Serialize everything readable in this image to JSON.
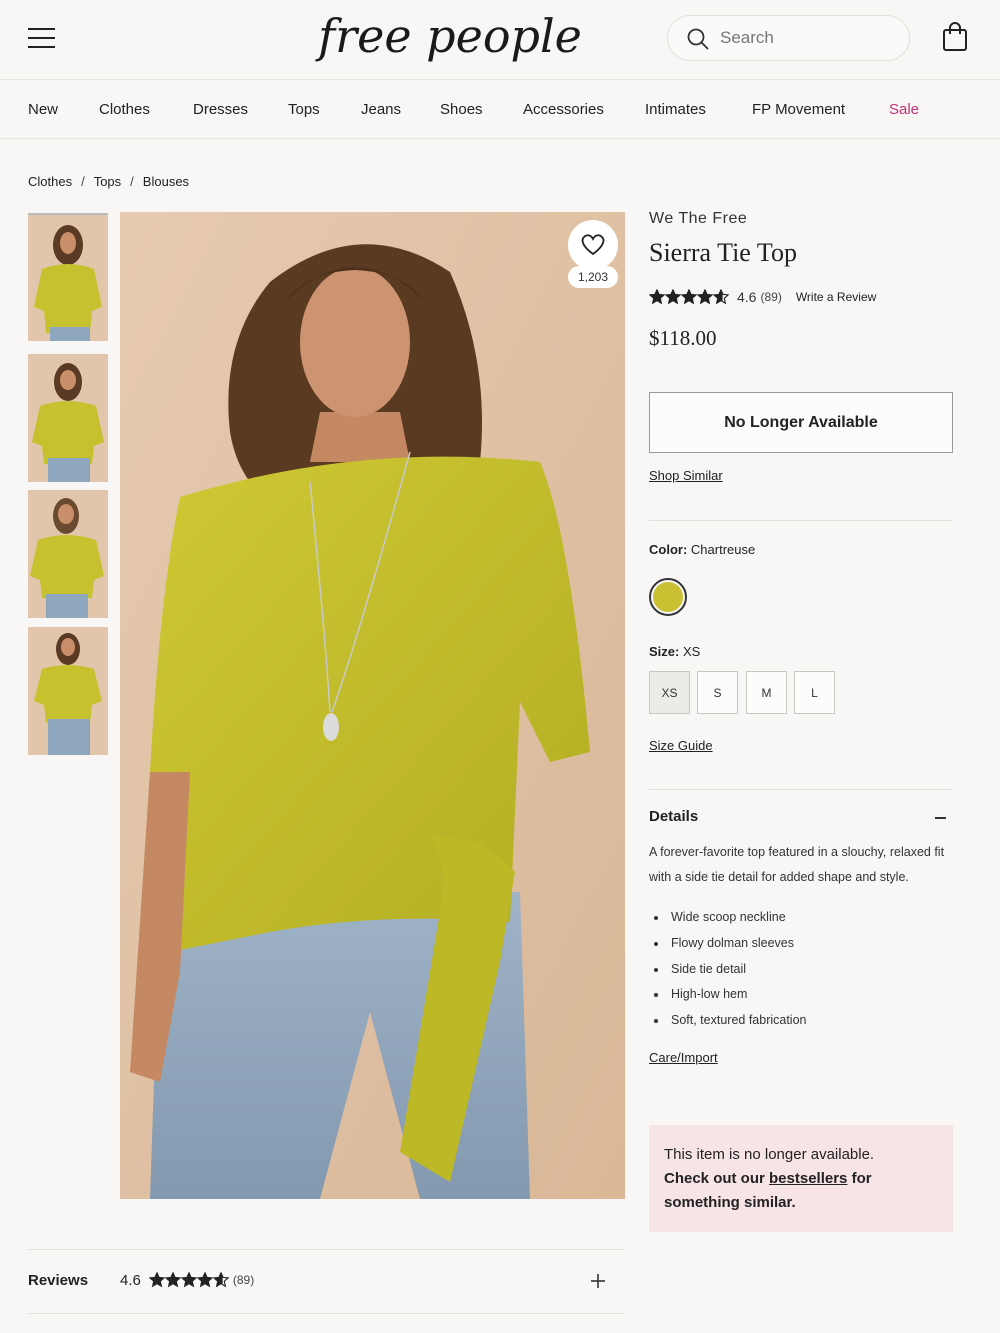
{
  "header": {
    "logo_text": "free people",
    "search_placeholder": "Search",
    "icons": [
      "hamburger-menu-icon",
      "search-icon",
      "shopping-bag-icon"
    ]
  },
  "nav": {
    "items": [
      "New",
      "Clothes",
      "Dresses",
      "Tops",
      "Jeans",
      "Shoes",
      "Accessories",
      "Intimates",
      "FP Movement",
      "Sale"
    ],
    "sale_color": "#c2307b"
  },
  "breadcrumb": [
    "Clothes",
    "Tops",
    "Blouses"
  ],
  "favorite": {
    "count": "1,203",
    "icon": "heart-icon"
  },
  "product": {
    "brand": "We The Free",
    "name": "Sierra Tie Top",
    "rating": "4.6",
    "rating_value": 4.6,
    "review_count": "(89)",
    "write_review": "Write a Review",
    "price": "$118.00",
    "availability_button": "No Longer Available",
    "shop_similar": "Shop Similar",
    "color_label": "Color:",
    "color_value": "Chartreuse",
    "swatch_color": "#c9c132",
    "size_label": "Size:",
    "size_value": "XS",
    "sizes": [
      "XS",
      "S",
      "M",
      "L"
    ],
    "size_guide": "Size Guide"
  },
  "details": {
    "heading": "Details",
    "description": "A forever-favorite top featured in a slouchy, relaxed fit with a side tie detail for added shape and style.",
    "bullets": [
      "Wide scoop neckline",
      "Flowy dolman sleeves",
      "Side tie detail",
      "High-low hem",
      "Soft, textured fabrication"
    ],
    "care_link": "Care/Import"
  },
  "notice": {
    "line1": "This item is no longer available.",
    "line2_pre": "Check out our ",
    "line2_link": "bestsellers",
    "line2_post": " for something similar.",
    "bg_color": "#f7e4e6"
  },
  "reviews": {
    "heading": "Reviews",
    "rating": "4.6",
    "count": "(89)"
  }
}
